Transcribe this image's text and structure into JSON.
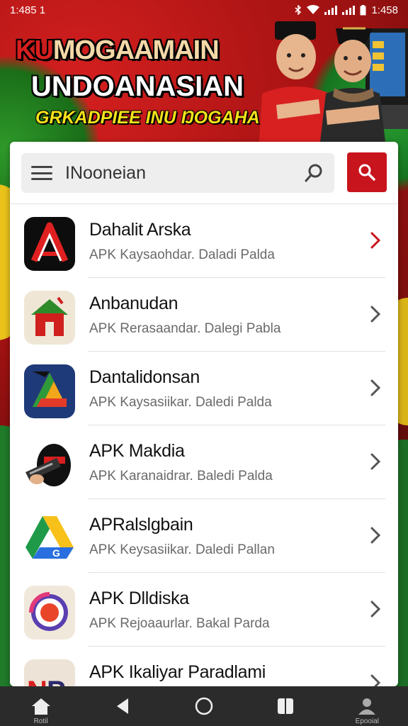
{
  "status_bar": {
    "time": "1:485 1",
    "right_time": "1:458"
  },
  "banner": {
    "line1_red": "KU",
    "line1_rest": "MOGAAMAIN",
    "line2": "UNDOANASIAN",
    "line3": "GRKADPIEE INU ŊOGAHA"
  },
  "search": {
    "placeholder": "INooneian"
  },
  "apps": [
    {
      "title": "Dahalit Arska",
      "subtitle": "APK Kaysaohdar. Daladi Palda",
      "icon": "red-a-logo-icon",
      "chevron_color": "#c8141c"
    },
    {
      "title": "Anbanudan",
      "subtitle": "APK Rerasaandar. Dalegi Pabla",
      "icon": "red-house-icon",
      "chevron_color": "#555555"
    },
    {
      "title": "Dantalidonsan",
      "subtitle": "APK Kaysasiikar. Daledi Palda",
      "icon": "triangle-drive-icon",
      "chevron_color": "#555555"
    },
    {
      "title": "APK Makdia",
      "subtitle": "APK Karanaidrar. Baledi Palda",
      "icon": "ninja-character-icon",
      "chevron_color": "#555555"
    },
    {
      "title": "APRalslgbain",
      "subtitle": "APK Keysasiikar. Daledi Pallan",
      "icon": "google-drive-icon",
      "chevron_color": "#555555"
    },
    {
      "title": "APK Dlldiska",
      "subtitle": "APK Rejoaaurlar. Bakal Parda",
      "icon": "circle-target-icon",
      "chevron_color": "#555555"
    },
    {
      "title": "APK Ikaliyar Paradlami",
      "subtitle": "",
      "icon": "np-logo-icon",
      "chevron_color": "#555555"
    }
  ],
  "navbar": [
    {
      "label": "Rotil",
      "icon": "home-icon"
    },
    {
      "label": "",
      "icon": "back-icon"
    },
    {
      "label": "",
      "icon": "circle-home-icon"
    },
    {
      "label": "",
      "icon": "book-icon"
    },
    {
      "label": "Epooial",
      "icon": "profile-icon"
    }
  ]
}
